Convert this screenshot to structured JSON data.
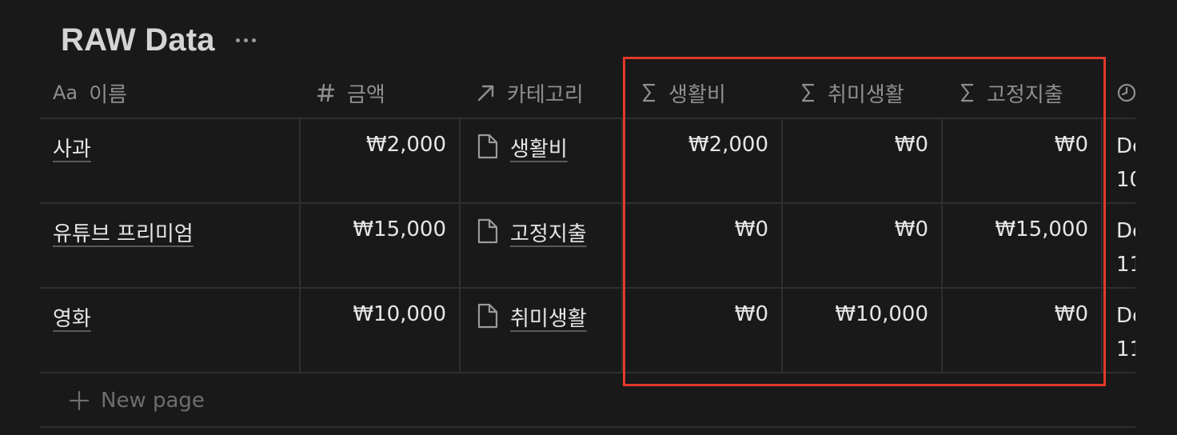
{
  "page": {
    "title": "RAW Data"
  },
  "columns": {
    "name": {
      "icon": "Aa",
      "label": "이름"
    },
    "amount": {
      "icon": "#",
      "label": "금액"
    },
    "category": {
      "label": "카테고리"
    },
    "living": {
      "label": "생활비"
    },
    "hobby": {
      "label": "취미생활"
    },
    "fixed": {
      "label": "고정지출"
    }
  },
  "rows": [
    {
      "name": "사과",
      "amount": "₩2,000",
      "category": "생활비",
      "living": "₩2,000",
      "hobby": "₩0",
      "fixed": "₩0",
      "date1": "De",
      "date2": "10"
    },
    {
      "name": "유튜브 프리미엄",
      "amount": "₩15,000",
      "category": "고정지출",
      "living": "₩0",
      "hobby": "₩0",
      "fixed": "₩15,000",
      "date1": "De",
      "date2": "11"
    },
    {
      "name": "영화",
      "amount": "₩10,000",
      "category": "취미생활",
      "living": "₩0",
      "hobby": "₩10,000",
      "fixed": "₩0",
      "date1": "De",
      "date2": "11"
    }
  ],
  "new_page": "New page",
  "colors": {
    "highlight": "#e03a2a",
    "background": "#191919"
  }
}
